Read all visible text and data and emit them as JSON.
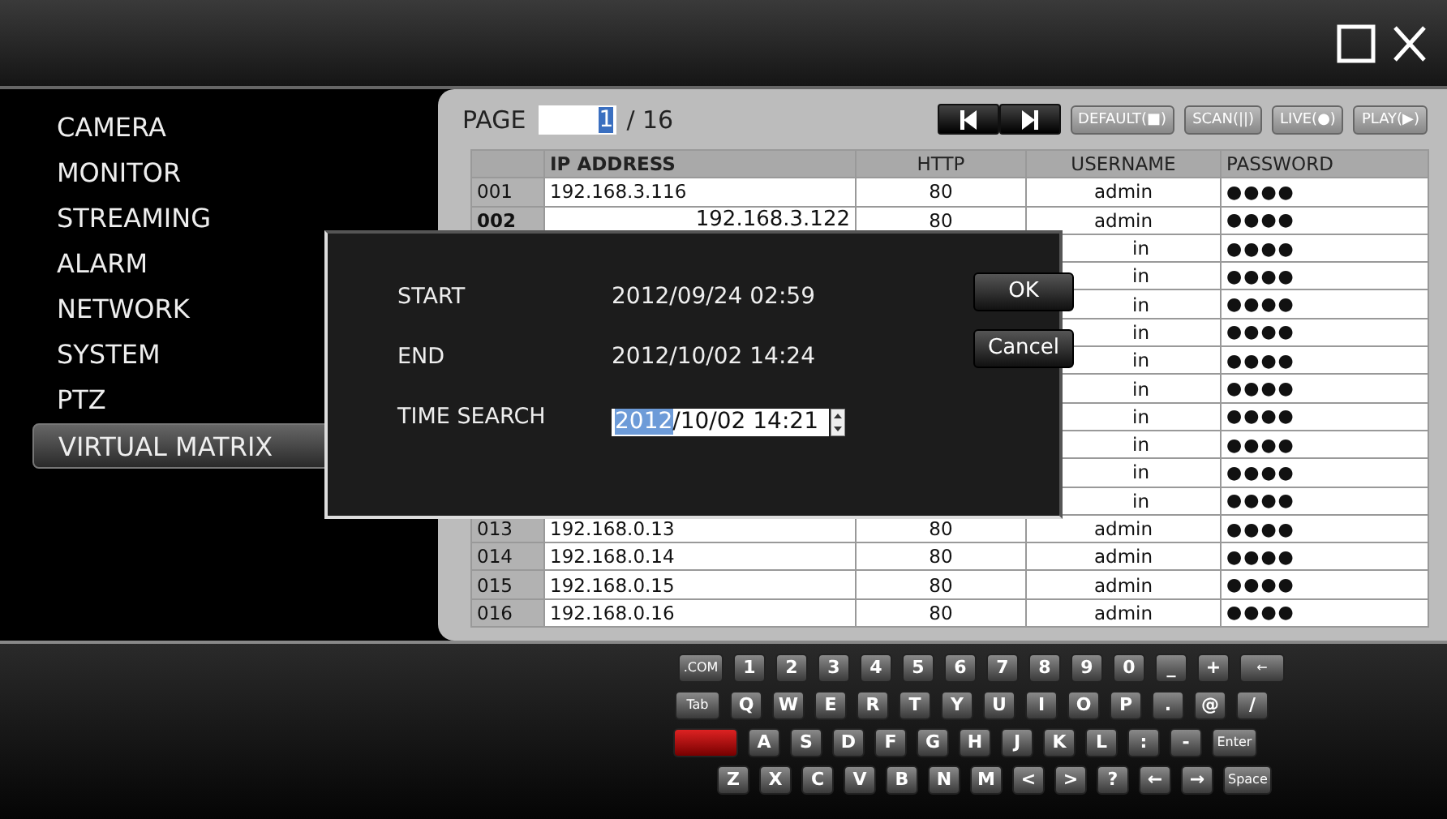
{
  "sidebar": {
    "items": [
      {
        "label": "CAMERA",
        "selected": false
      },
      {
        "label": "MONITOR",
        "selected": false
      },
      {
        "label": "STREAMING",
        "selected": false
      },
      {
        "label": "ALARM",
        "selected": false
      },
      {
        "label": "NETWORK",
        "selected": false
      },
      {
        "label": "SYSTEM",
        "selected": false
      },
      {
        "label": "PTZ",
        "selected": false
      },
      {
        "label": "VIRTUAL MATRIX",
        "selected": true
      }
    ]
  },
  "pager": {
    "label": "PAGE",
    "value": "1",
    "total": "/ 16"
  },
  "toolbar": {
    "buttons": [
      "DEFAULT(■)",
      "SCAN(||)",
      "LIVE(●)",
      "PLAY(▶)"
    ]
  },
  "table": {
    "columns": [
      "IP ADDRESS",
      "HTTP",
      "USERNAME",
      "PASSWORD"
    ],
    "rows": [
      {
        "no": "001",
        "ip": "192.168.3.116",
        "http": "80",
        "username": "admin",
        "password": "●●●●",
        "editing": false
      },
      {
        "no": "002",
        "ip": "192.168.3.122",
        "http": "80",
        "username": "admin",
        "password": "●●●●",
        "editing": true
      },
      {
        "username": "in",
        "password": "●●●●"
      },
      {
        "username": "in",
        "password": "●●●●"
      },
      {
        "username": "in",
        "password": "●●●●"
      },
      {
        "username": "in",
        "password": "●●●●"
      },
      {
        "username": "in",
        "password": "●●●●"
      },
      {
        "username": "in",
        "password": "●●●●"
      },
      {
        "username": "in",
        "password": "●●●●"
      },
      {
        "username": "in",
        "password": "●●●●"
      },
      {
        "username": "in",
        "password": "●●●●"
      },
      {
        "username": "in",
        "password": "●●●●"
      },
      {
        "no": "013",
        "ip": "192.168.0.13",
        "http": "80",
        "username": "admin",
        "password": "●●●●",
        "editing": false
      },
      {
        "no": "014",
        "ip": "192.168.0.14",
        "http": "80",
        "username": "admin",
        "password": "●●●●",
        "editing": false
      },
      {
        "no": "015",
        "ip": "192.168.0.15",
        "http": "80",
        "username": "admin",
        "password": "●●●●",
        "editing": false
      },
      {
        "no": "016",
        "ip": "192.168.0.16",
        "http": "80",
        "username": "admin",
        "password": "●●●●",
        "editing": false
      }
    ]
  },
  "dialog": {
    "fields": [
      {
        "kind": "text",
        "label": "START",
        "value": "2012/09/24 02:59"
      },
      {
        "kind": "text",
        "label": "END",
        "value": "2012/10/02 14:24"
      },
      {
        "kind": "spin",
        "label": "TIME SEARCH",
        "highlight": "2012",
        "value": "/10/02 14:21"
      }
    ],
    "buttons": [
      "OK",
      "Cancel"
    ]
  },
  "keyboard": {
    "rows": [
      [
        {
          "kind": "wide",
          "label": ".COM"
        },
        {
          "kind": "key",
          "label": "1"
        },
        {
          "kind": "key",
          "label": "2"
        },
        {
          "kind": "key",
          "label": "3"
        },
        {
          "kind": "key",
          "label": "4"
        },
        {
          "kind": "key",
          "label": "5"
        },
        {
          "kind": "key",
          "label": "6"
        },
        {
          "kind": "key",
          "label": "7"
        },
        {
          "kind": "key",
          "label": "8"
        },
        {
          "kind": "key",
          "label": "9"
        },
        {
          "kind": "key",
          "label": "0"
        },
        {
          "kind": "key",
          "label": "_"
        },
        {
          "kind": "key",
          "label": "+"
        },
        {
          "kind": "wide",
          "label": "←"
        }
      ],
      [
        {
          "kind": "wide",
          "label": "Tab"
        },
        {
          "kind": "key",
          "label": "Q"
        },
        {
          "kind": "key",
          "label": "W"
        },
        {
          "kind": "key",
          "label": "E"
        },
        {
          "kind": "key",
          "label": "R"
        },
        {
          "kind": "key",
          "label": "T"
        },
        {
          "kind": "key",
          "label": "Y"
        },
        {
          "kind": "key",
          "label": "U"
        },
        {
          "kind": "key",
          "label": "I"
        },
        {
          "kind": "key",
          "label": "O"
        },
        {
          "kind": "key",
          "label": "P"
        },
        {
          "kind": "key",
          "label": "."
        },
        {
          "kind": "key",
          "label": "@"
        },
        {
          "kind": "key",
          "label": "/"
        }
      ],
      [
        {
          "kind": "accent"
        },
        {
          "kind": "key",
          "label": "A"
        },
        {
          "kind": "key",
          "label": "S"
        },
        {
          "kind": "key",
          "label": "D"
        },
        {
          "kind": "key",
          "label": "F"
        },
        {
          "kind": "key",
          "label": "G"
        },
        {
          "kind": "key",
          "label": "H"
        },
        {
          "kind": "key",
          "label": "J"
        },
        {
          "kind": "key",
          "label": "K"
        },
        {
          "kind": "key",
          "label": "L"
        },
        {
          "kind": "key",
          "label": ":"
        },
        {
          "kind": "key",
          "label": "-"
        },
        {
          "kind": "wide",
          "label": "Enter"
        }
      ],
      [
        {
          "kind": "key",
          "label": "Z"
        },
        {
          "kind": "key",
          "label": "X"
        },
        {
          "kind": "key",
          "label": "C"
        },
        {
          "kind": "key",
          "label": "V"
        },
        {
          "kind": "key",
          "label": "B"
        },
        {
          "kind": "key",
          "label": "N"
        },
        {
          "kind": "key",
          "label": "M"
        },
        {
          "kind": "key",
          "label": "<"
        },
        {
          "kind": "key",
          "label": ">"
        },
        {
          "kind": "key",
          "label": "?"
        },
        {
          "kind": "key",
          "label": "←"
        },
        {
          "kind": "key",
          "label": "→"
        },
        {
          "kind": "wide",
          "label": "Space"
        }
      ]
    ]
  }
}
